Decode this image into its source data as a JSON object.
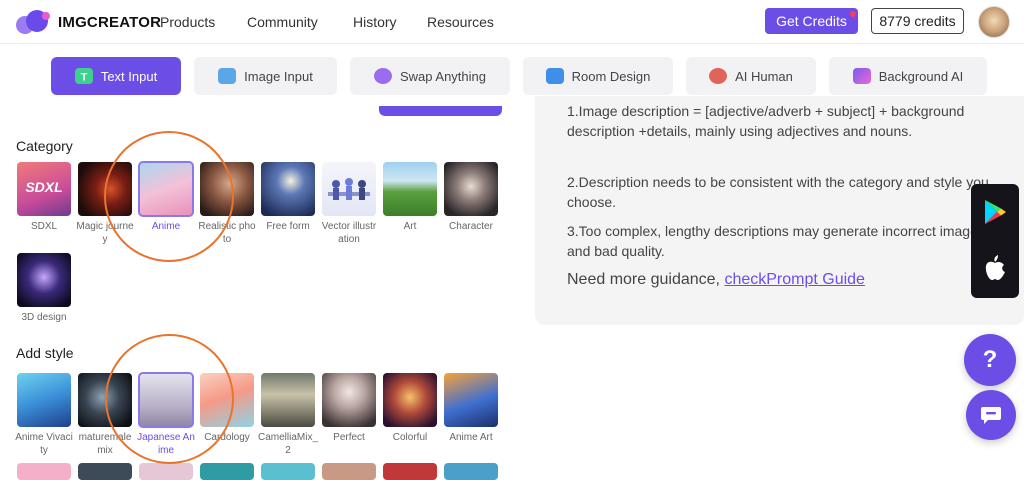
{
  "header": {
    "logo_text": "IMGCREATOR",
    "nav": [
      "Products",
      "Community",
      "History",
      "Resources"
    ],
    "get_credits": "Get Credits",
    "credits": "8779 credits"
  },
  "tabs": [
    {
      "label": "Text Input",
      "icon": "text-input-icon",
      "active": true
    },
    {
      "label": "Image Input",
      "icon": "image-input-icon"
    },
    {
      "label": "Swap Anything",
      "icon": "swap-icon"
    },
    {
      "label": "Room Design",
      "icon": "room-icon"
    },
    {
      "label": "AI Human",
      "icon": "ai-human-icon"
    },
    {
      "label": "Background AI",
      "icon": "background-icon"
    }
  ],
  "category": {
    "title": "Category",
    "items": [
      {
        "label": "SDXL"
      },
      {
        "label": "Magic journey"
      },
      {
        "label": "Anime",
        "selected": true
      },
      {
        "label": "Realistic photo"
      },
      {
        "label": "Free form"
      },
      {
        "label": "Vector illustration"
      },
      {
        "label": "Art"
      },
      {
        "label": "Character"
      },
      {
        "label": "3D design"
      }
    ]
  },
  "style": {
    "title": "Add style",
    "items": [
      {
        "label": "Anime Vivacity"
      },
      {
        "label": "maturemalemix"
      },
      {
        "label": "Japanese Anime",
        "selected": true
      },
      {
        "label": "Cardology"
      },
      {
        "label": "CamelliaMix_2"
      },
      {
        "label": "Perfect"
      },
      {
        "label": "Colorful"
      },
      {
        "label": "Anime Art"
      }
    ]
  },
  "tips": {
    "tip1": "1.Image description = [adjective/adverb + subject] + background description +details, mainly using adjectives and nouns.",
    "tip2": "2.Description needs to be consistent with the category and style you choose.",
    "tip3": "3.Too complex, lengthy descriptions may generate incorrect images and bad quality.",
    "guide_text": "Need more guidance, ",
    "guide_link": "checkPrompt Guide"
  },
  "help_label": "?",
  "colors": {
    "accent": "#6c4de6",
    "highlight_ring": "#e8742e"
  }
}
